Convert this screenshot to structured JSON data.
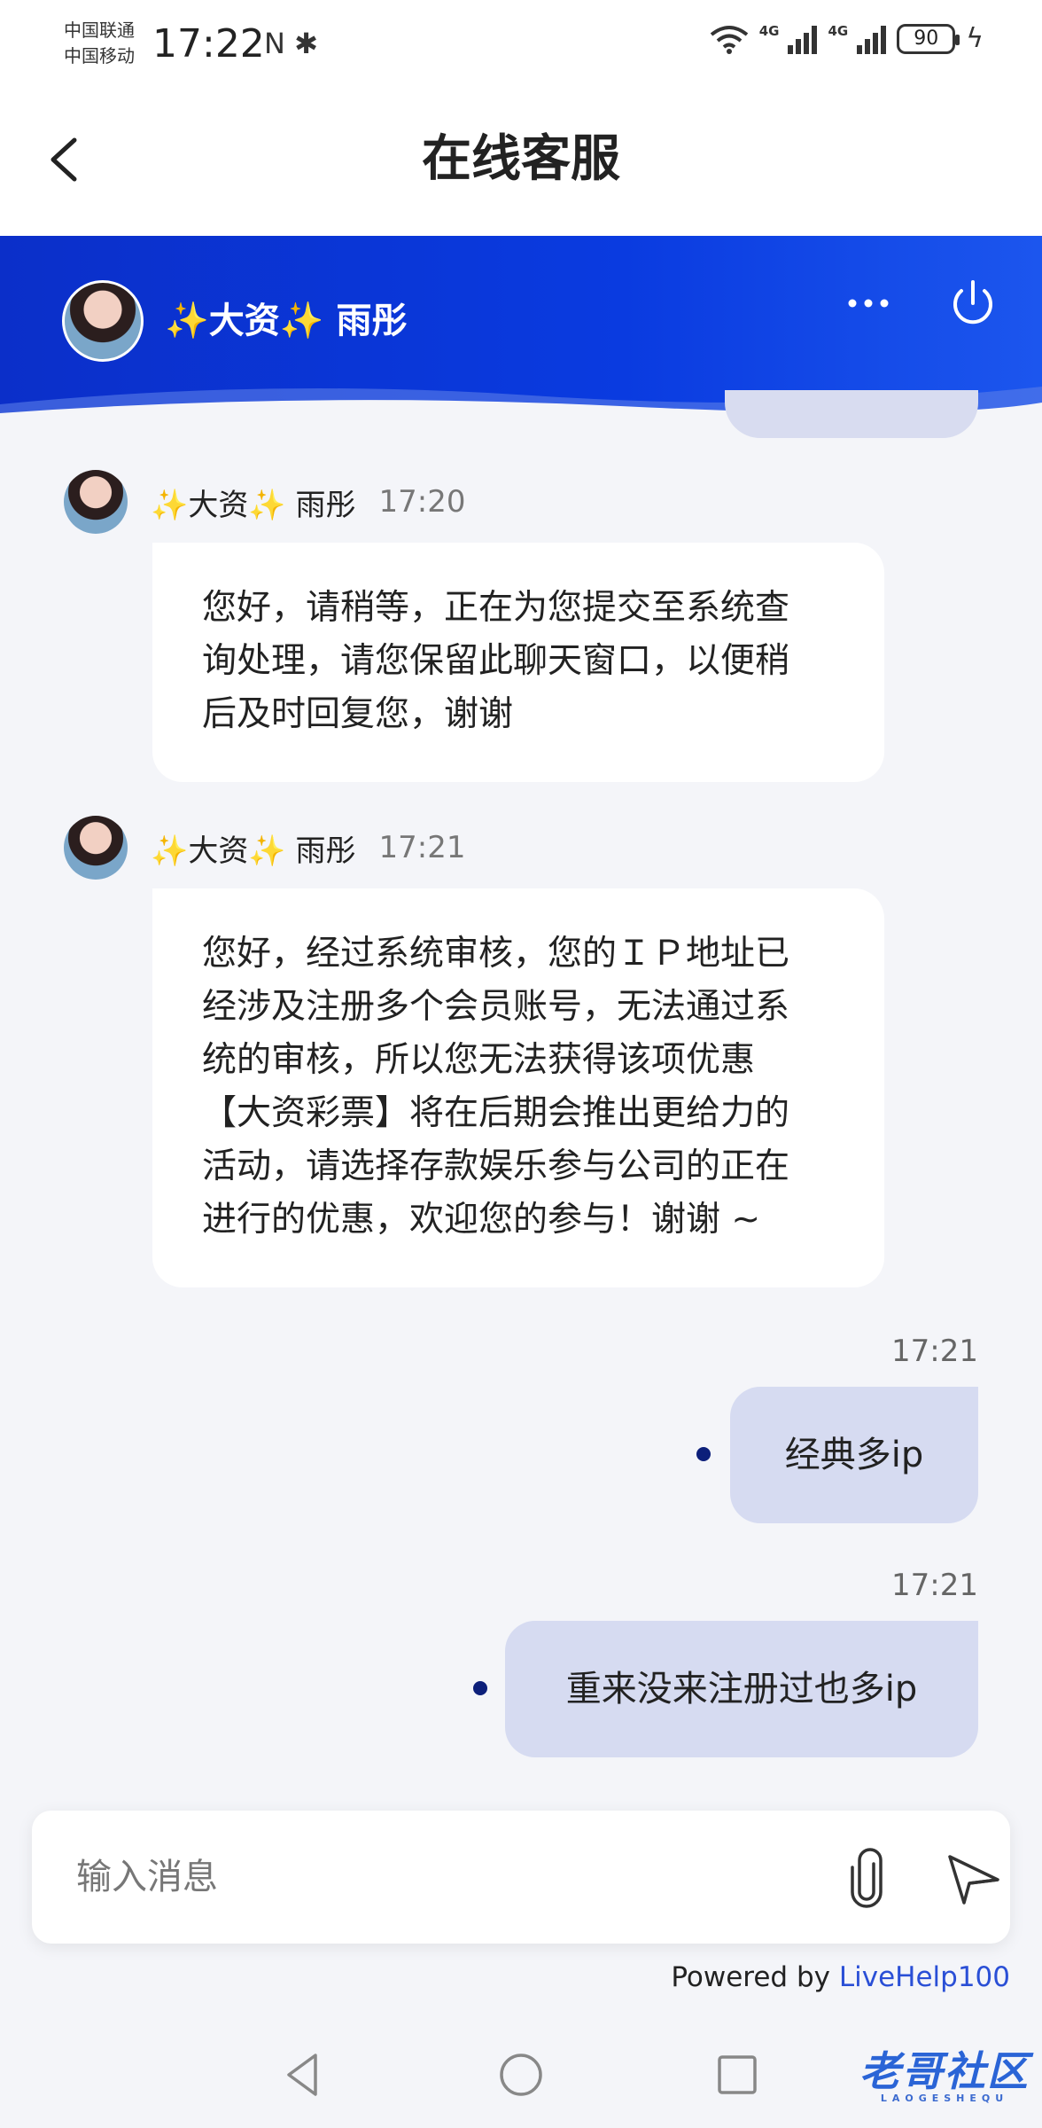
{
  "status_bar": {
    "carrier_1": "中国联通",
    "carrier_2": "中国移动",
    "time": "17:22",
    "left_icons": "N ✱",
    "net_1": "4G",
    "net_2": "4G",
    "battery": "90",
    "icons": [
      "nfc-icon",
      "bluetooth-icon",
      "wifi-icon",
      "signal-icon",
      "battery-icon",
      "charging-icon"
    ]
  },
  "nav": {
    "title": "在线客服"
  },
  "agent": {
    "name": "✨大资✨ 雨彤"
  },
  "messages": [
    {
      "direction": "in",
      "sender": "✨大资✨ 雨彤",
      "time": "17:20",
      "text": "您好，请稍等，正在为您提交至系统查\n询处理，请您保留此聊天窗口，以便稍\n后及时回复您，谢谢"
    },
    {
      "direction": "in",
      "sender": "✨大资✨ 雨彤",
      "time": "17:21",
      "text": "您好，经过系统审核，您的ＩＰ地址已\n经涉及注册多个会员账号，无法通过系\n统的审核，所以您无法获得该项优惠\n【大资彩票】将在后期会推出更给力的\n活动，请选择存款娱乐参与公司的正在\n进行的优惠，欢迎您的参与！谢谢 ~"
    },
    {
      "direction": "out",
      "time": "17:21",
      "text": "经典多ip"
    },
    {
      "direction": "out",
      "time": "17:21",
      "text": "重来没来注册过也多ip"
    }
  ],
  "composer": {
    "placeholder": "输入消息"
  },
  "footer": {
    "powered_prefix": "Powered by ",
    "powered_link": "LiveHelp100"
  },
  "watermark": {
    "text": "老哥社区",
    "sub": "LAOGESHEQU"
  },
  "colors": {
    "header_blue": "#0a3be0",
    "out_bubble": "#d6dbf1",
    "link": "#2a4fd6"
  }
}
